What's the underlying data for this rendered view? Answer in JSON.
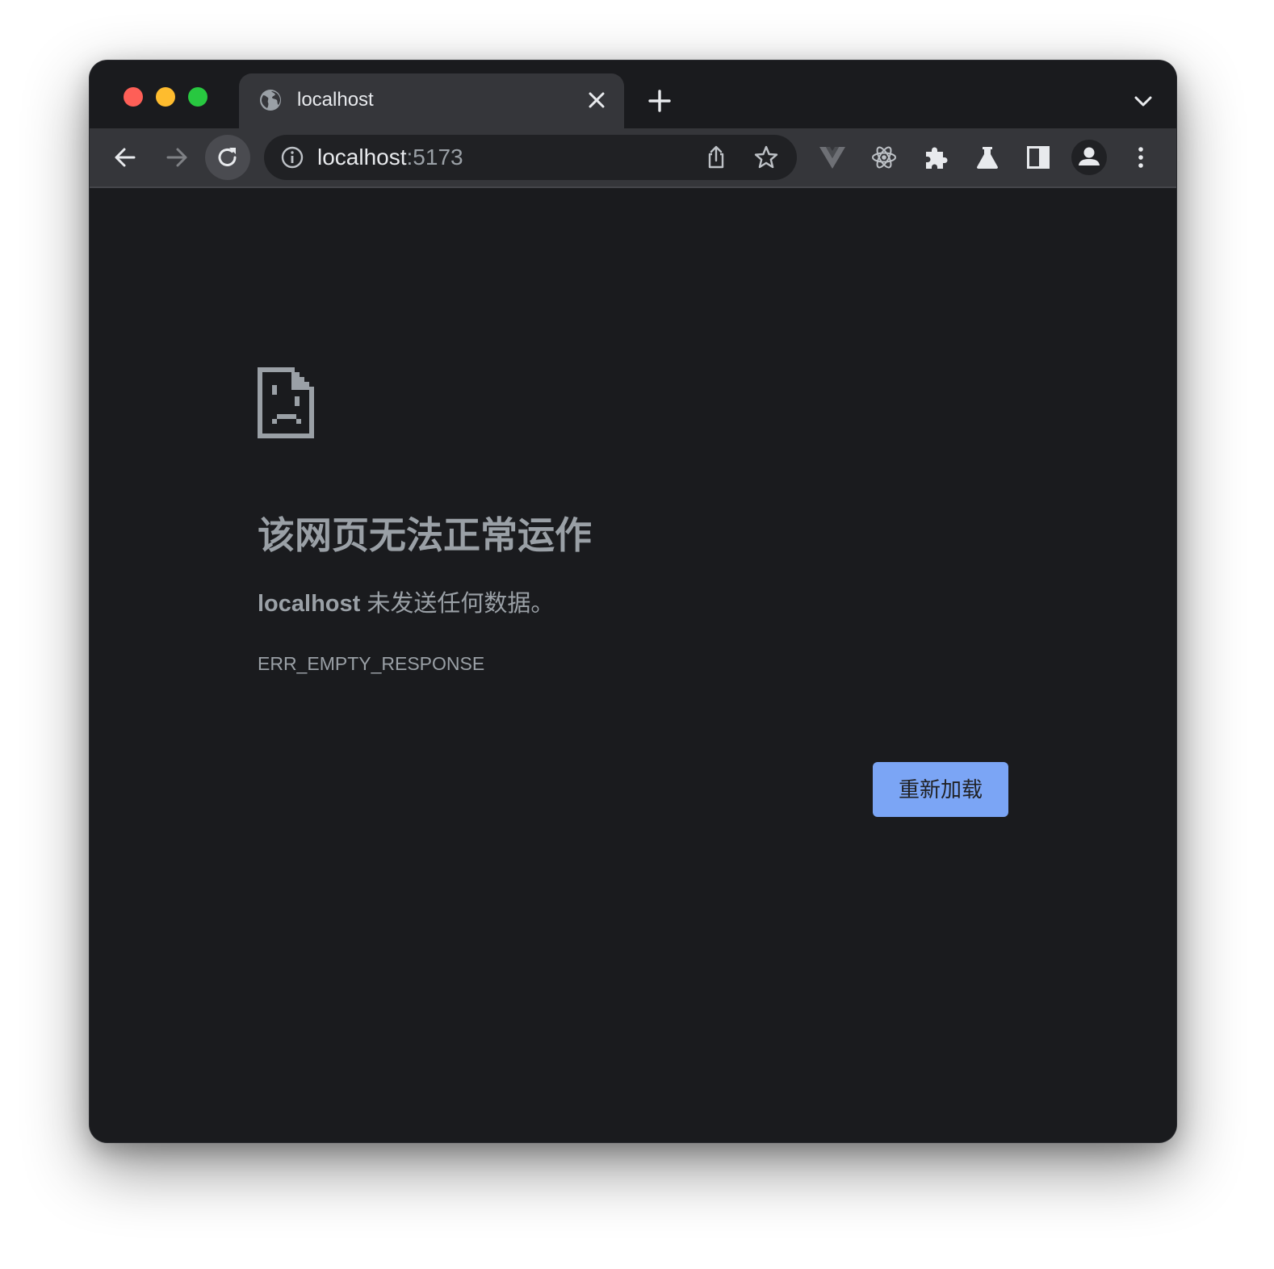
{
  "window": {
    "traffic_lights": [
      "close",
      "minimize",
      "zoom"
    ]
  },
  "tab": {
    "favicon": "globe-icon",
    "title": "localhost",
    "close_icon": "close-icon"
  },
  "tabstrip": {
    "new_tab_icon": "plus-icon",
    "tab_search_icon": "chevron-down-icon"
  },
  "toolbar": {
    "back_icon": "arrow-left-icon",
    "forward_icon": "arrow-right-icon",
    "reload_icon": "reload-icon",
    "omnibox": {
      "info_icon": "info-icon",
      "host": "localhost",
      "port": ":5173",
      "share_icon": "share-icon",
      "bookmark_icon": "star-icon"
    },
    "extensions": [
      "vue-devtools-icon",
      "react-devtools-icon",
      "extensions-puzzle-icon",
      "labs-flask-icon",
      "side-panel-icon",
      "profile-avatar-icon",
      "more-menu-icon"
    ]
  },
  "error_page": {
    "icon": "sad-page-icon",
    "heading": "该网页无法正常运作",
    "detail_host": "localhost",
    "detail_text": " 未发送任何数据。",
    "error_code": "ERR_EMPTY_RESPONSE",
    "reload_button": "重新加载"
  },
  "colors": {
    "window_bg": "#1a1b1e",
    "toolbar_bg": "#35363a",
    "omnibox_bg": "#202124",
    "text_muted": "#9aa0a6",
    "button_accent": "#7ba5f5"
  }
}
